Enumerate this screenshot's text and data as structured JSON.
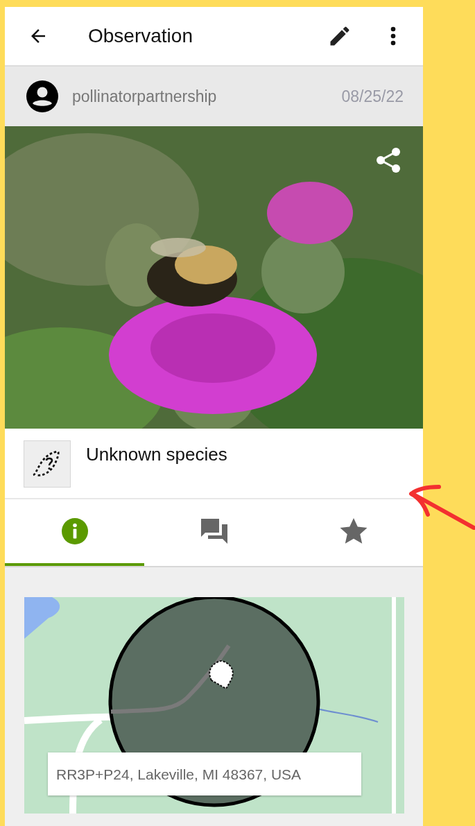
{
  "app_bar": {
    "title": "Observation"
  },
  "observer": {
    "username": "pollinatorpartnership",
    "date": "08/25/22"
  },
  "taxon": {
    "name": "Unknown species"
  },
  "tabs": [
    {
      "kind": "info",
      "selected": true
    },
    {
      "kind": "comments",
      "selected": false
    },
    {
      "kind": "favorites",
      "selected": false
    }
  ],
  "location": {
    "address": "RR3P+P24, Lakeville, MI 48367, USA"
  }
}
